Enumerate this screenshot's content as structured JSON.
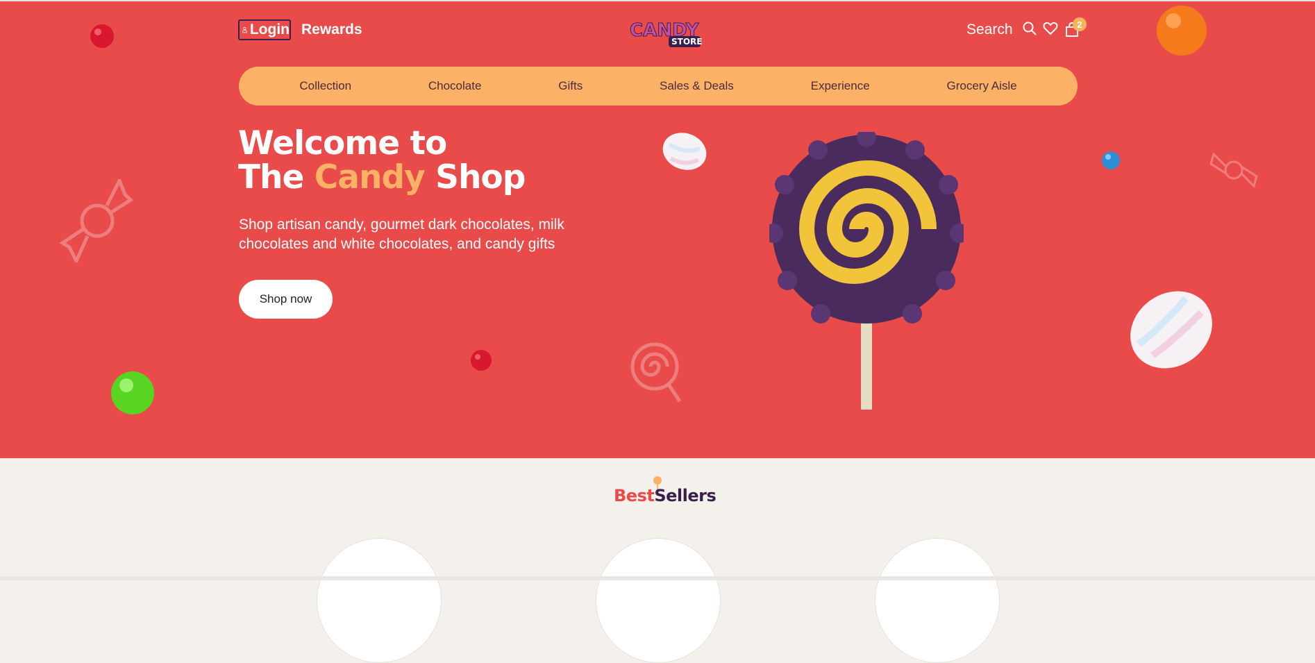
{
  "header": {
    "login_label": "Login",
    "rewards_label": "Rewards",
    "logo_top": "CANDY",
    "logo_bottom": "STORE",
    "search_label": "Search",
    "cart_count": "2"
  },
  "nav": {
    "items": [
      {
        "label": "Collection"
      },
      {
        "label": "Chocolate"
      },
      {
        "label": "Gifts"
      },
      {
        "label": "Sales & Deals"
      },
      {
        "label": "Experience"
      },
      {
        "label": "Grocery Aisle"
      }
    ]
  },
  "hero": {
    "title_line1": "Welcome to",
    "title_the": "The",
    "title_candy": "Candy",
    "title_shop": "Shop",
    "subtitle": "Shop artisan candy, gourmet dark chocolates, milk chocolates and white chocolates, and candy gifts",
    "cta_label": "Shop now"
  },
  "bestsellers": {
    "title_part1": "Best",
    "title_part2": "Sellers"
  },
  "colors": {
    "hero_bg": "#e94b4b",
    "nav_bg": "#fbb267",
    "accent": "#fbb267",
    "page_bg": "#f4f0ec",
    "dark_purple": "#3a1f4a"
  },
  "icons": [
    "user-icon",
    "search-icon",
    "heart-icon",
    "cart-icon"
  ]
}
